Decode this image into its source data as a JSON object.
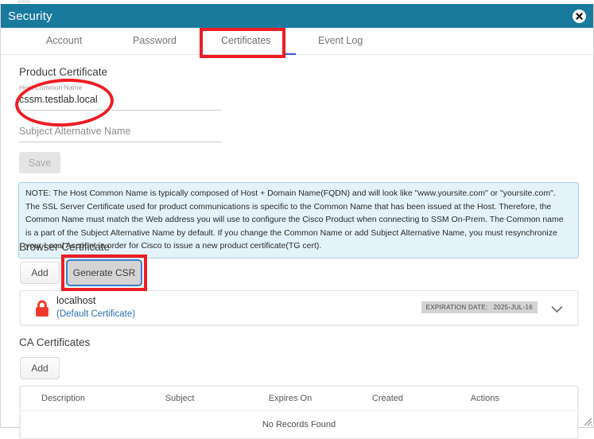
{
  "window": {
    "title": "Security",
    "close_icon": "close-icon"
  },
  "tabs": [
    {
      "id": "account",
      "label": "Account",
      "active": false
    },
    {
      "id": "password",
      "label": "Password",
      "active": false
    },
    {
      "id": "certificates",
      "label": "Certificates",
      "active": true
    },
    {
      "id": "eventlog",
      "label": "Event Log",
      "active": false
    }
  ],
  "product_certificate": {
    "heading": "Product Certificate",
    "host_common_name": {
      "label": "Host Common Name",
      "value": "cssm.testlab.local"
    },
    "subject_alternative_name": {
      "placeholder": "Subject Alternative Name",
      "value": ""
    },
    "save_label": "Save"
  },
  "note": {
    "text": "NOTE: The Host Common Name is typically composed of Host + Domain Name(FQDN) and will look like \"www.yoursite.com\" or \"yoursite.com\". The SSL Server Certificate used for product communications is specific to the Common Name that has been issued at the Host. Therefore, the Common Name must match the Web address you will use to configure the Cisco Product when connecting to SSM On-Prem. The Common name is a part of the Subject Alternative Name by default. If you change the Common Name or add Subject Alternative Name, you must resynchronize your Local Account in order for Cisco to issue a new product certificate(TG cert)."
  },
  "browser_certificate": {
    "heading": "Browser Certificate",
    "add_label": "Add",
    "generate_csr_label": "Generate CSR",
    "certificate": {
      "name": "localhost",
      "subtitle": "(Default Certificate)",
      "expiration_label": "EXPIRATION DATE:",
      "expiration_value": "2025-JUL-16",
      "lock_icon": "lock-icon",
      "expand_icon": "chevron-down-icon"
    }
  },
  "ca_certificates": {
    "heading": "CA Certificates",
    "add_label": "Add",
    "columns": [
      "Description",
      "Subject",
      "Expires On",
      "Created",
      "Actions"
    ],
    "empty_message": "No Records Found",
    "rows": []
  },
  "colors": {
    "title_bar": "#1a7a9e",
    "annotation": "#ee1c24",
    "note_bg": "#e3f3f9",
    "note_border": "#a9cfdd",
    "link": "#2d6cb5",
    "lock": "#f0392b",
    "active_tab_underline": "#3658c4"
  }
}
